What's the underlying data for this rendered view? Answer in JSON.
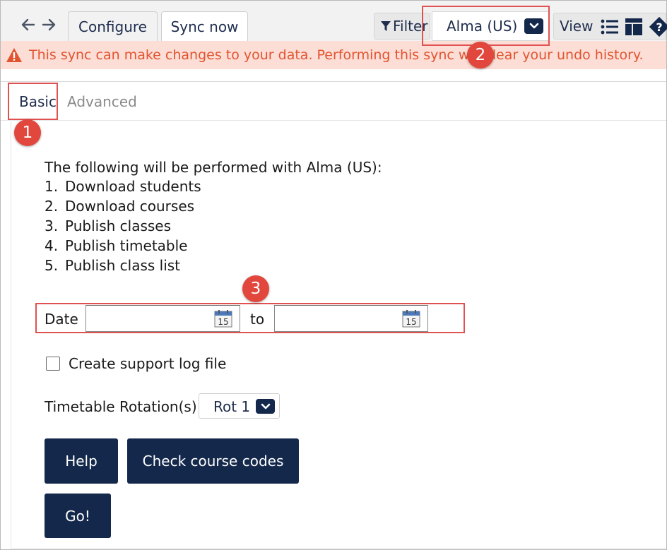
{
  "colors": {
    "accent_navy": "#14284b",
    "warning_text": "#e2532f",
    "warning_background": "#fcded6",
    "annotation_red": "#e05252"
  },
  "toolbar": {
    "back_icon": "arrow-left-icon",
    "forward_icon": "arrow-right-icon",
    "tabs": [
      {
        "label": "Configure",
        "active": false
      },
      {
        "label": "Sync now",
        "active": true
      }
    ],
    "filter_label": "Filter",
    "source_select_value": "Alma (US)",
    "view_label": "View",
    "icons": [
      "list-icon",
      "layout-icon",
      "help-icon"
    ]
  },
  "warning": {
    "icon": "warning-icon",
    "text": "This sync can make changes to your data. Performing this sync will clear your undo history."
  },
  "subtabs": [
    {
      "label": "Basic",
      "active": true
    },
    {
      "label": "Advanced",
      "active": false
    }
  ],
  "content": {
    "intro": "The following will be performed with Alma (US):",
    "steps": [
      {
        "num": "1.",
        "text": "Download students"
      },
      {
        "num": "2.",
        "text": "Download courses"
      },
      {
        "num": "3.",
        "text": "Publish classes"
      },
      {
        "num": "4.",
        "text": "Publish timetable"
      },
      {
        "num": "5.",
        "text": "Publish class list"
      }
    ],
    "date_label": "Date",
    "to_label": "to",
    "date_from_value": "",
    "date_to_value": "",
    "calendar_icon_day": "15",
    "support_log_label": "Create support log file",
    "support_log_checked": false,
    "rotation_label": "Timetable Rotation(s)",
    "rotation_value": "Rot 1",
    "buttons": {
      "help": "Help",
      "check_course_codes": "Check course codes",
      "go": "Go!"
    }
  },
  "annotations": {
    "badge_1": "1",
    "badge_2": "2",
    "badge_3": "3"
  }
}
